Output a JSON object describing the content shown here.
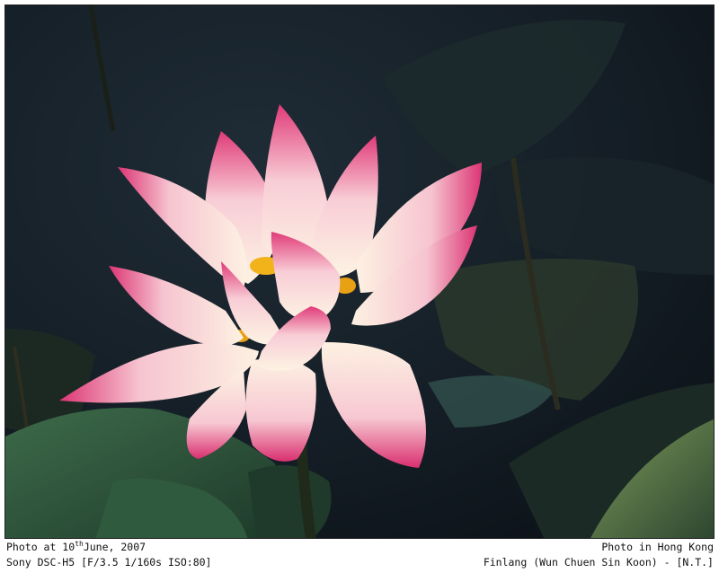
{
  "caption": {
    "left_line1_prefix": "Photo at 10",
    "left_line1_sup": "th",
    "left_line1_suffix": "June, 2007",
    "left_line2": "Sony DSC-H5 [F/3.5 1/160s ISO:80]",
    "right_line1": "Photo in Hong Kong",
    "right_line2": "Finlang (Wun Chuen Sin Koon) - [N.T.]"
  },
  "colors": {
    "background_dark": "#121a22",
    "leaf_green": "#2f5a3e",
    "petal_pink": "#e0407a",
    "petal_cream": "#fbeedd",
    "stamen_yellow": "#f2b21a"
  }
}
